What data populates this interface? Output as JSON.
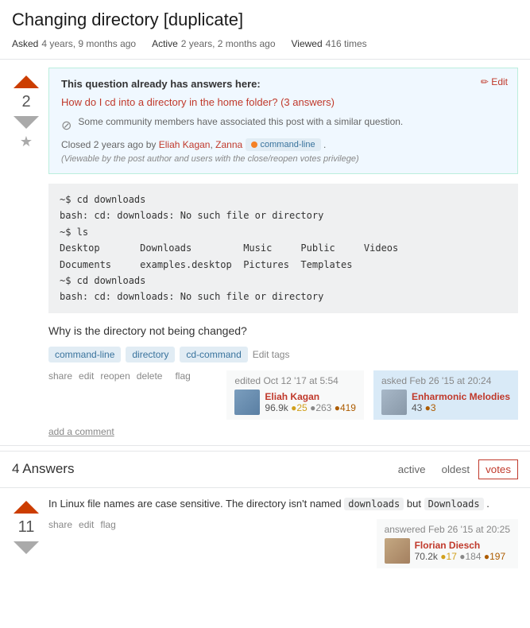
{
  "page": {
    "title": "Changing directory [duplicate]",
    "meta": {
      "asked_label": "Asked",
      "asked_time": "4 years, 9 months ago",
      "active_label": "Active",
      "active_time": "2 years, 2 months ago",
      "viewed_label": "Viewed",
      "viewed_count": "416 times"
    }
  },
  "vote": {
    "count": "2",
    "up_label": "▲",
    "down_label": "▼",
    "star_label": "★"
  },
  "duplicate": {
    "title": "This question already has answers here:",
    "link_text": "How do I cd into a directory in the home folder?",
    "answers_text": "(3 answers)",
    "edit_label": "✏ Edit",
    "community_text": "Some community members have associated this post with a similar question.",
    "closed_text": "Closed 2 years ago by",
    "closed_by": [
      "Eliah Kagan",
      "Zanna"
    ],
    "tag_label": "command-line",
    "viewable_note": "(Viewable by the post author and users with the close/reopen votes privilege)"
  },
  "code": {
    "lines": [
      "~$ cd downloads",
      "bash: cd: downloads: No such file or directory",
      "~$ ls",
      "Desktop       Downloads         Music     Public     Videos",
      "Documents     examples.desktop  Pictures  Templates",
      "~$ cd downloads",
      "bash: cd: downloads: No such file or directory"
    ]
  },
  "question": {
    "text": "Why is the directory not being changed?",
    "tags": [
      "command-line",
      "directory",
      "cd-command"
    ],
    "edit_tags_label": "Edit tags"
  },
  "actions": {
    "share": "share",
    "edit": "edit",
    "reopen": "reopen",
    "delete": "delete",
    "flag": "flag",
    "add_comment": "add a comment"
  },
  "edited": {
    "label": "edited",
    "date": "Oct 12 '17 at 5:54",
    "username": "Eliah Kagan",
    "rep": "96.9k",
    "badges": {
      "gold": "25",
      "silver": "263",
      "bronze": "419"
    }
  },
  "asked": {
    "label": "asked",
    "date": "Feb 26 '15 at 20:24",
    "username": "Enharmonic Melodies",
    "rep": "43",
    "badges": {
      "bronze": "3"
    }
  },
  "answers": {
    "count": "4",
    "title_label": "Answers",
    "sort_options": [
      "active",
      "oldest",
      "votes"
    ],
    "active_sort": "votes"
  },
  "answer1": {
    "vote_count": "11",
    "text_before": "In Linux file names are case sensitive. The directory isn't named",
    "inline_code1": "downloads",
    "text_middle": "but",
    "inline_code2": "Downloads",
    "text_after": ".",
    "actions": {
      "share": "share",
      "edit": "edit",
      "flag": "flag"
    },
    "answered_label": "answered",
    "answered_date": "Feb 26 '15 at 20:25",
    "username": "Florian Diesch",
    "rep": "70.2k",
    "badges": {
      "gold": "17",
      "silver": "184",
      "bronze": "197"
    }
  }
}
